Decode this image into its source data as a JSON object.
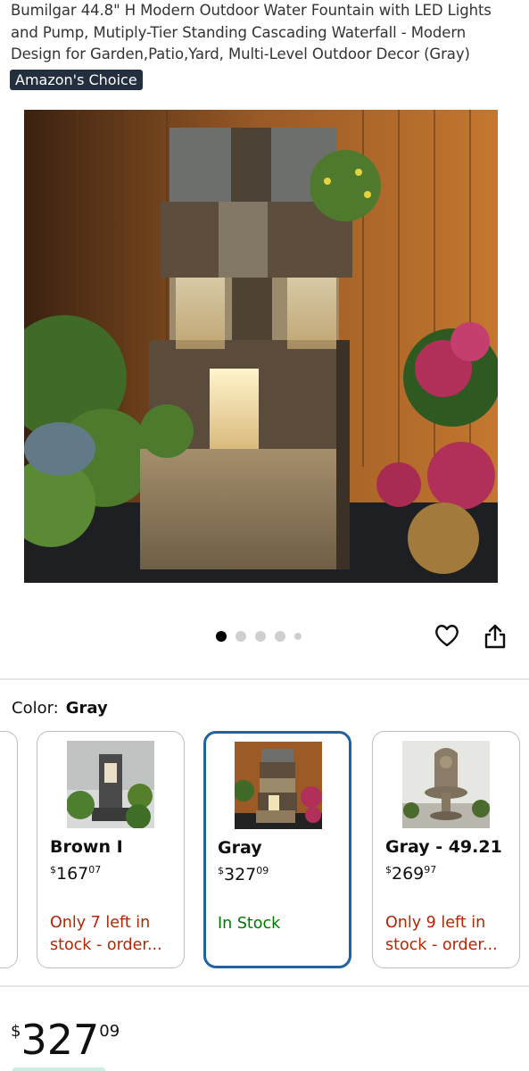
{
  "product": {
    "title": "Bumilgar 44.8\" H Modern Outdoor Water Fountain with LED Lights and Pump, Mutiply-Tier Standing Cascading Waterfall - Modern Design for Garden,Patio,Yard, Multi-Level Outdoor Decor (Gray)",
    "badge": "Amazon's Choice"
  },
  "gallery": {
    "image_count": 5,
    "active_index": 0,
    "icons": [
      "heart-icon",
      "share-icon"
    ]
  },
  "color_selector": {
    "label": "Color:",
    "selected": "Gray",
    "options": [
      {
        "name": "Brown I",
        "price_currency": "$",
        "price_whole": "167",
        "price_fraction": "07",
        "stock": "Only 7 left in stock - order...",
        "stock_status": "low"
      },
      {
        "name": "Gray",
        "price_currency": "$",
        "price_whole": "327",
        "price_fraction": "09",
        "stock": "In Stock",
        "stock_status": "ok"
      },
      {
        "name": "Gray - 49.21",
        "price_currency": "$",
        "price_whole": "269",
        "price_fraction": "97",
        "stock": "Only 9 left in stock - order...",
        "stock_status": "low"
      }
    ]
  },
  "price": {
    "currency": "$",
    "whole": "327",
    "fraction": "09"
  },
  "colors": {
    "badge_bg": "#232f3e",
    "selected_border": "#2162a1",
    "low_stock": "#b12704",
    "in_stock": "#007600"
  }
}
